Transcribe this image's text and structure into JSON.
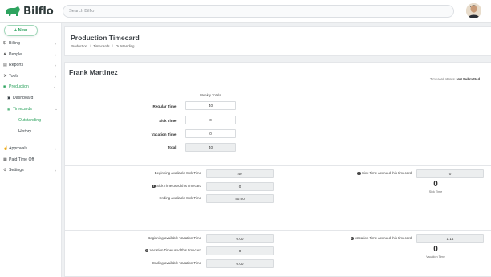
{
  "app": {
    "name": "Bilflo"
  },
  "search": {
    "placeholder": "Search Bilflo"
  },
  "sidebar": {
    "new_label": "+ New",
    "items": [
      {
        "label": "Billing",
        "icon": "dollar-icon"
      },
      {
        "label": "People",
        "icon": "people-icon"
      },
      {
        "label": "Reports",
        "icon": "chart-icon"
      },
      {
        "label": "Tools",
        "icon": "wrench-icon"
      },
      {
        "label": "Production",
        "icon": "briefcase-icon"
      }
    ],
    "production_sub": {
      "dashboard": "Dashboard",
      "timecards": "Timecards",
      "outstanding": "Outstanding",
      "history": "History"
    },
    "bottom_items": [
      {
        "label": "Approvals",
        "icon": "thumbs-up-icon"
      },
      {
        "label": "Paid Time Off",
        "icon": "calendar-icon"
      },
      {
        "label": "Settings",
        "icon": "gear-icon"
      }
    ]
  },
  "header": {
    "title": "Production Timecard",
    "breadcrumb": [
      "Production",
      "Timecards",
      "Outstanding"
    ]
  },
  "timecard": {
    "employee": "Frank Martinez",
    "status_label": "Timecard status:",
    "status_value": "Not Submitted",
    "weekly_title": "Weekly Totals",
    "regular_label": "Regular Time:",
    "regular_value": "40",
    "sick_label": "Sick Time:",
    "sick_value": "0",
    "vacation_label": "Vacation Time:",
    "vacation_value": "0",
    "total_label": "Total:",
    "total_value": "40"
  },
  "sick": {
    "beginning_label": "Beginning available Sick Time",
    "beginning_value": "40",
    "used_label": "Sick Time used this timecard",
    "used_value": "0",
    "ending_label": "Ending available Sick Time",
    "ending_value": "40.00",
    "accrued_label": "Sick Time accrued this timecard",
    "accrued_value": "0",
    "big_number": "0",
    "big_caption": "Sick Time"
  },
  "vacation": {
    "beginning_label": "Beginning available Vacation Time",
    "beginning_value": "0.00",
    "used_label": "Vacation Time used this timecard",
    "used_value": "0",
    "ending_label": "Ending available Vacation Time",
    "ending_value": "0.00",
    "accrued_label": "Vacation Time accrued this timecard",
    "accrued_value": "1.14",
    "big_number": "0",
    "big_caption": "Vacation Time"
  },
  "colors": {
    "brand_green": "#2ea35f",
    "logo_dark": "#2f3a3a"
  }
}
